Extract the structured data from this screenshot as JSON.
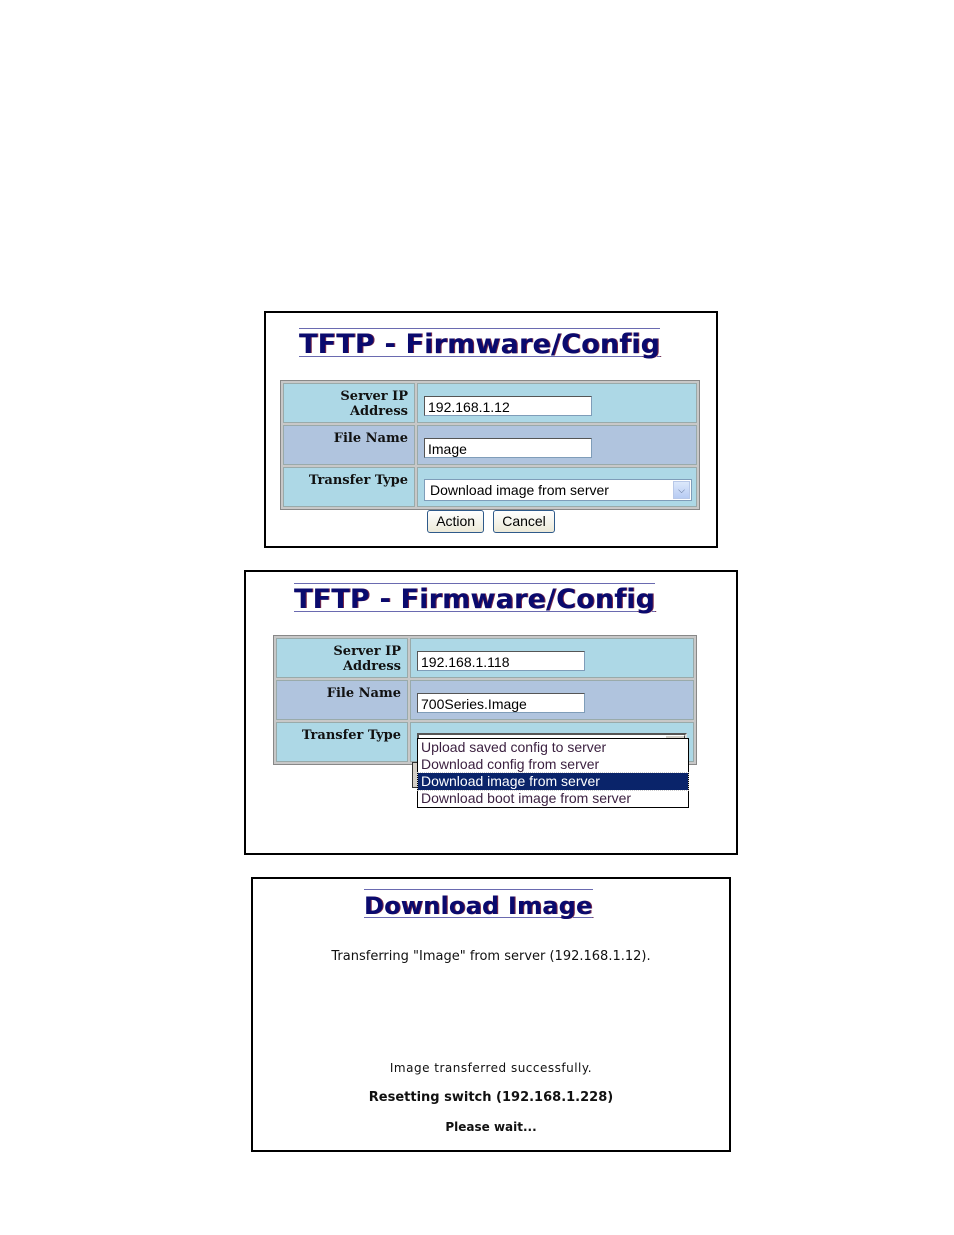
{
  "panels": [
    {
      "title": "TFTP - Firmware/Config",
      "fields": {
        "server_ip_label": "Server IP Address",
        "server_ip_value": "192.168.1.12",
        "file_name_label": "File Name",
        "file_name_value": "Image",
        "transfer_type_label": "Transfer Type",
        "transfer_type_value": "Download image from server"
      },
      "buttons": {
        "action": "Action",
        "cancel": "Cancel"
      },
      "icons": {
        "select_arrow": "chevron-down-icon"
      }
    },
    {
      "title": "TFTP - Firmware/Config",
      "fields": {
        "server_ip_label": "Server IP Address",
        "server_ip_value": "192.168.1.118",
        "file_name_label": "File Name",
        "file_name_value": "700Series.Image",
        "transfer_type_label": "Transfer Type",
        "transfer_type_value": "Download image from server"
      },
      "dropdown_options": [
        "Upload saved config to server",
        "Download config from server",
        "Download image from server",
        "Download boot image from server"
      ],
      "selected_option_index": 2,
      "icons": {
        "select_arrow": "triangle-down-icon"
      }
    },
    {
      "title": "Download Image",
      "messages": {
        "transferring": "Transferring \"Image\" from server (192.168.1.12).",
        "success": "Image transferred successfully.",
        "resetting": "Resetting switch (192.168.1.228)",
        "wait": "Please wait..."
      }
    }
  ],
  "colors": {
    "title": "#0a0a6e",
    "row_light": "#add8e6",
    "row_dark": "#b0c4de",
    "selected_option_bg": "#0a246a"
  }
}
